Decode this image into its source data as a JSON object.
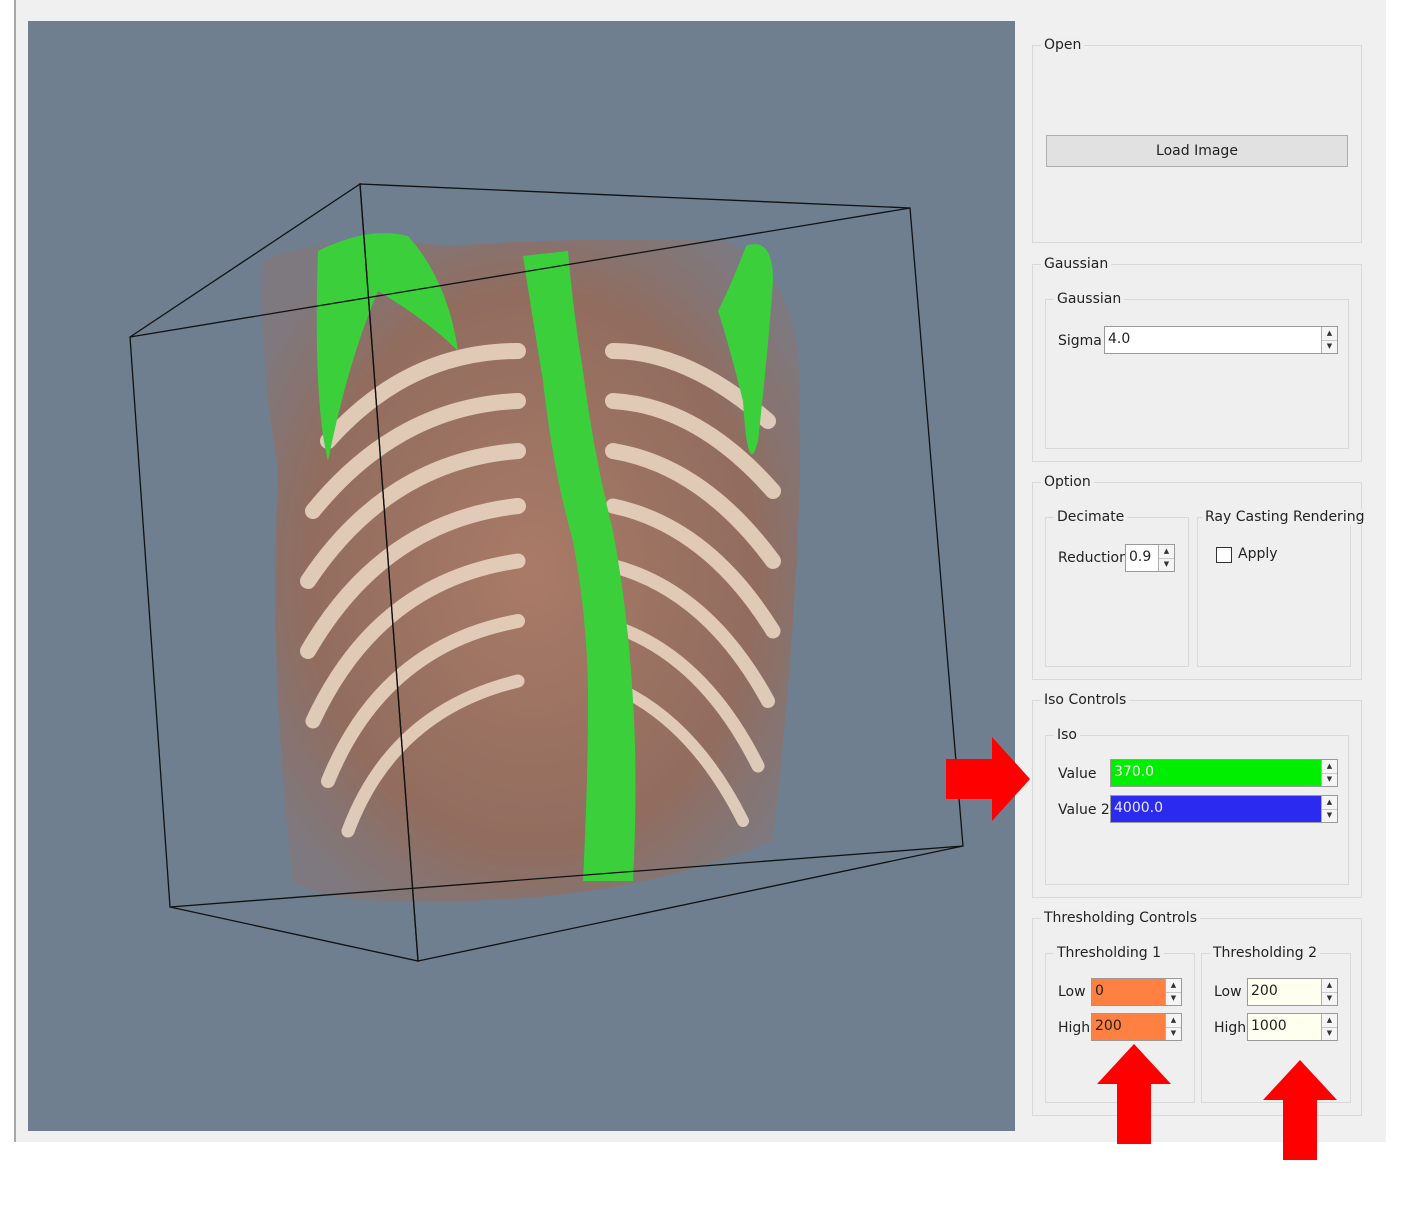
{
  "panel": {
    "open": {
      "title": "Open",
      "load_button": "Load Image"
    },
    "gaussian": {
      "title": "Gaussian",
      "inner_title": "Gaussian",
      "sigma_label": "Sigma",
      "sigma_value": "4.0"
    },
    "option": {
      "title": "Option",
      "decimate": {
        "title": "Decimate",
        "reduction_label": "Reduction",
        "reduction_value": "0.9"
      },
      "raycast": {
        "title": "Ray Casting Rendering",
        "apply_label": "Apply",
        "apply_checked": false
      }
    },
    "iso": {
      "title": "Iso Controls",
      "inner_title": "Iso",
      "value_label": "Value",
      "value": "370.0",
      "value_color": "#00ee00",
      "value2_label": "Value 2",
      "value2": "4000.0",
      "value2_color": "#2a2af0"
    },
    "threshold": {
      "title": "Thresholding Controls",
      "t1": {
        "title": "Thresholding 1",
        "low_label": "Low",
        "low_value": "0",
        "high_label": "High",
        "high_value": "200",
        "color": "#ff8040"
      },
      "t2": {
        "title": "Thresholding 2",
        "low_label": "Low",
        "low_value": "200",
        "high_label": "High",
        "high_value": "1000",
        "color": "#fffff0"
      }
    }
  },
  "colors": {
    "viewport_bg": "#6f7f90",
    "annotation_arrow": "#ff0000"
  }
}
